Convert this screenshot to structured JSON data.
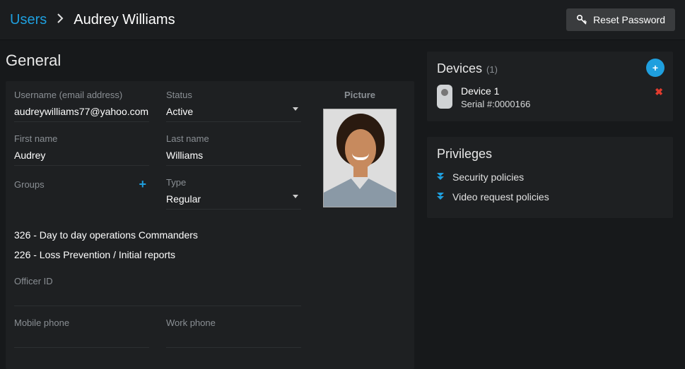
{
  "header": {
    "breadcrumb_root": "Users",
    "breadcrumb_current": "Audrey Williams",
    "reset_password_label": "Reset Password"
  },
  "general": {
    "title": "General",
    "labels": {
      "username": "Username (email address)",
      "status": "Status",
      "first_name": "First name",
      "last_name": "Last name",
      "groups": "Groups",
      "type": "Type",
      "officer_id": "Officer ID",
      "mobile_phone": "Mobile phone",
      "work_phone": "Work phone",
      "picture": "Picture"
    },
    "values": {
      "username": "audreywilliams77@yahoo.com",
      "status": "Active",
      "first_name": "Audrey",
      "last_name": "Williams",
      "type": "Regular",
      "officer_id": "",
      "mobile_phone": "",
      "work_phone": ""
    },
    "groups": [
      "326 - Day to day operations Commanders",
      "226 - Loss Prevention / Initial reports"
    ]
  },
  "devices": {
    "title": "Devices",
    "count": "(1)",
    "items": [
      {
        "name": "Device 1",
        "serial_label": "Serial #:",
        "serial": "0000166"
      }
    ]
  },
  "privileges": {
    "title": "Privileges",
    "items": [
      "Security policies",
      "Video request policies"
    ]
  }
}
